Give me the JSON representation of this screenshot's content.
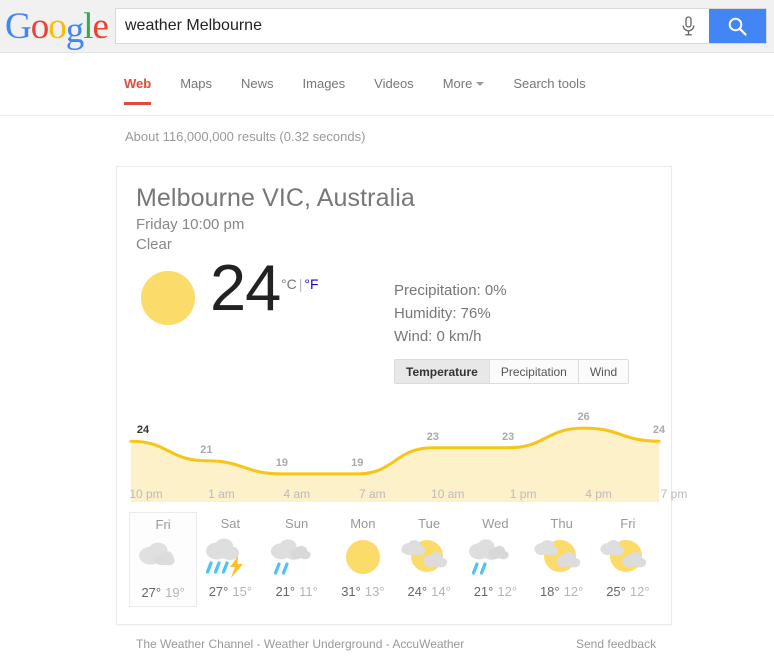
{
  "brand": {
    "logo_letters": [
      {
        "ch": "G",
        "color": "#4285f4"
      },
      {
        "ch": "o",
        "color": "#ea4335"
      },
      {
        "ch": "o",
        "color": "#fbbc05"
      },
      {
        "ch": "g",
        "color": "#4285f4"
      },
      {
        "ch": "l",
        "color": "#34a853"
      },
      {
        "ch": "e",
        "color": "#ea4335"
      }
    ]
  },
  "search": {
    "query": "weather Melbourne",
    "placeholder": "Search",
    "mic_icon": "microphone-icon",
    "search_icon": "search-icon",
    "button_color": "#4285f4"
  },
  "nav": {
    "tabs": [
      {
        "label": "Web",
        "active": true
      },
      {
        "label": "Maps",
        "active": false
      },
      {
        "label": "News",
        "active": false
      },
      {
        "label": "Images",
        "active": false
      },
      {
        "label": "Videos",
        "active": false
      },
      {
        "label": "More",
        "active": false,
        "caret": true
      }
    ],
    "search_tools": "Search tools",
    "active_color": "#dd4b39"
  },
  "result_stats": "About 116,000,000 results (0.32 seconds)",
  "weather": {
    "location": "Melbourne VIC, Australia",
    "datetime": "Friday 10:00 pm",
    "condition": "Clear",
    "current_temp": "24",
    "unit_selected": "°C",
    "unit_separator": "|",
    "unit_alternate": "°F",
    "unit_link_color": "#1a0dab",
    "icon": "sun-icon",
    "icon_color": "#fbdb6a",
    "details": [
      "Precipitation: 0%",
      "Humidity: 76%",
      "Wind: 0 km/h"
    ],
    "metric_tabs": [
      {
        "label": "Temperature",
        "active": true
      },
      {
        "label": "Precipitation",
        "active": false
      },
      {
        "label": "Wind",
        "active": false
      }
    ],
    "forecast": [
      {
        "day": "Fri",
        "icon": "cloudy-icon",
        "high": "27°",
        "low": "19°",
        "selected": true
      },
      {
        "day": "Sat",
        "icon": "thunderstorm-icon",
        "high": "27°",
        "low": "15°",
        "selected": false
      },
      {
        "day": "Sun",
        "icon": "rain-icon",
        "high": "21°",
        "low": "11°",
        "selected": false
      },
      {
        "day": "Mon",
        "icon": "sunny-icon",
        "high": "31°",
        "low": "13°",
        "selected": false
      },
      {
        "day": "Tue",
        "icon": "partly-cloudy-icon",
        "high": "24°",
        "low": "14°",
        "selected": false
      },
      {
        "day": "Wed",
        "icon": "rain-icon",
        "high": "21°",
        "low": "12°",
        "selected": false
      },
      {
        "day": "Thu",
        "icon": "partly-cloudy-icon",
        "high": "18°",
        "low": "12°",
        "selected": false
      },
      {
        "day": "Fri",
        "icon": "partly-cloudy-icon",
        "high": "25°",
        "low": "12°",
        "selected": false
      }
    ]
  },
  "chart_data": {
    "type": "area",
    "title": "",
    "xlabel": "",
    "ylabel": "",
    "x": [
      "10 pm",
      "1 am",
      "4 am",
      "7 am",
      "10 am",
      "1 pm",
      "4 pm",
      "7 pm"
    ],
    "values": [
      24,
      21,
      19,
      19,
      23,
      23,
      26,
      24
    ],
    "point_labels": [
      "24",
      "21",
      "19",
      "19",
      "23",
      "23",
      "26",
      "24"
    ],
    "ylim": [
      17,
      28
    ],
    "grid": false,
    "legend": "none",
    "line_color": "#f5c518",
    "fill_color": "#fcf1c9",
    "series": [
      {
        "name": "Temperature",
        "values": [
          24,
          21,
          19,
          19,
          23,
          23,
          26,
          24
        ]
      }
    ]
  },
  "footer": {
    "sources": [
      {
        "label": "The Weather Channel"
      },
      {
        "label": "Weather Underground"
      },
      {
        "label": "AccuWeather"
      }
    ],
    "separator": " - ",
    "send_feedback": "Send feedback"
  }
}
